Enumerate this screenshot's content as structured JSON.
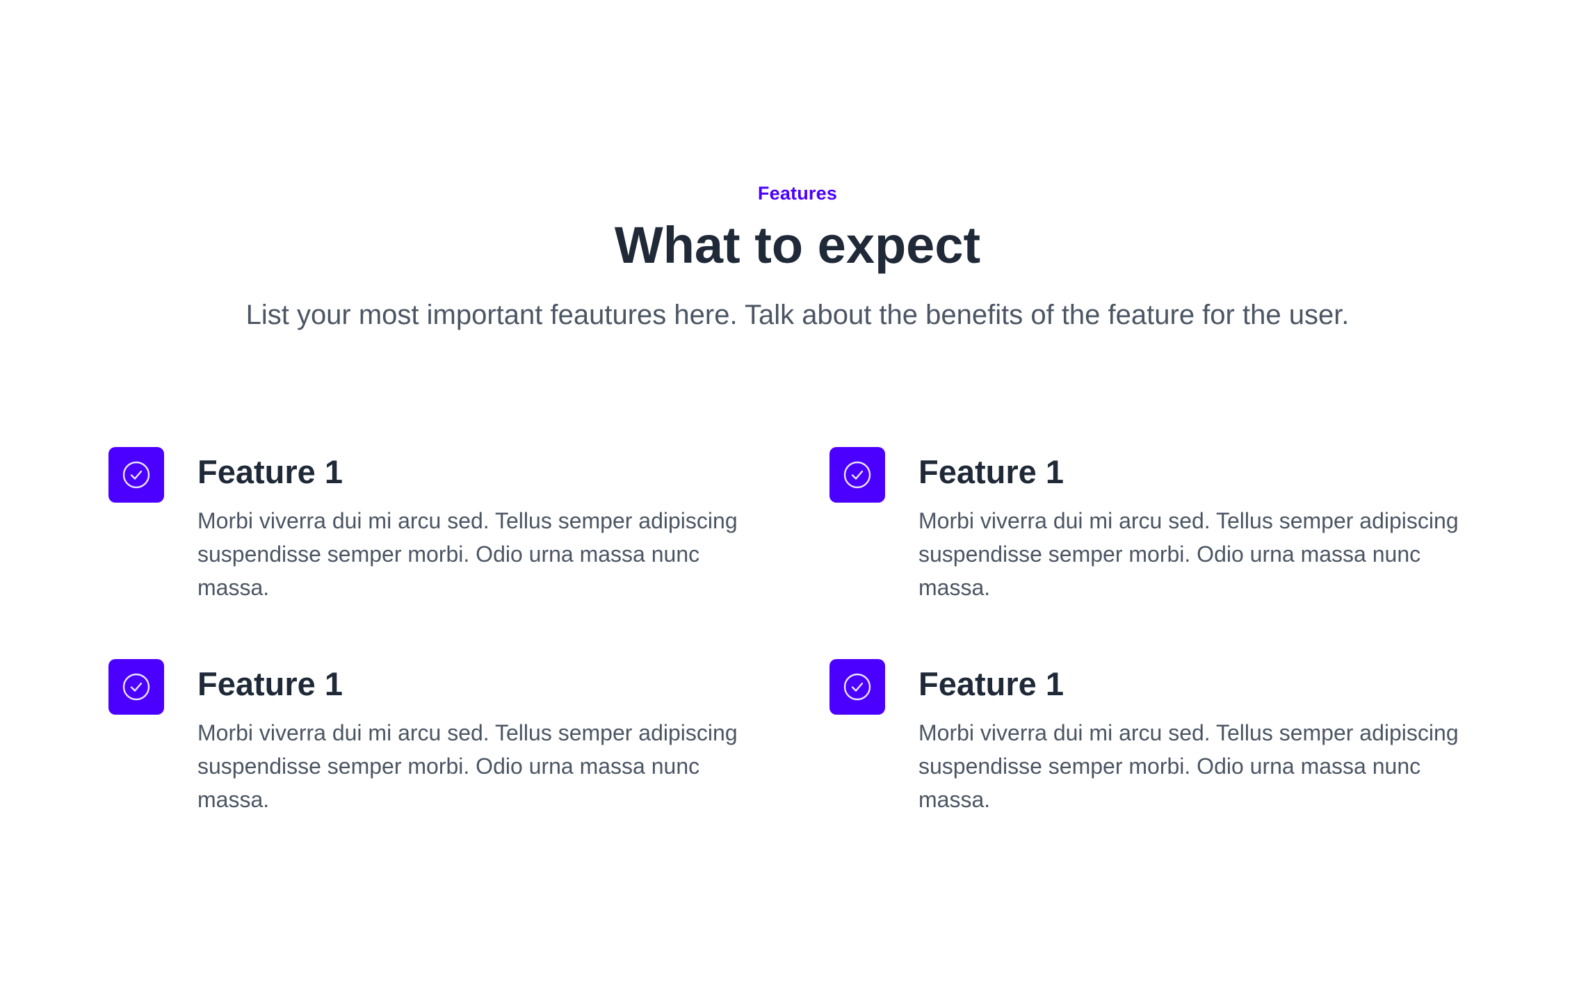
{
  "header": {
    "eyebrow": "Features",
    "title": "What to expect",
    "subtitle": "List your most important feautures here. Talk about the benefits of the feature for the user."
  },
  "features": [
    {
      "icon": "check-circle-icon",
      "title": "Feature 1",
      "description": "Morbi viverra dui mi arcu sed. Tellus semper adipiscing suspendisse semper morbi. Odio urna massa nunc massa."
    },
    {
      "icon": "check-circle-icon",
      "title": "Feature 1",
      "description": "Morbi viverra dui mi arcu sed. Tellus semper adipiscing suspendisse semper morbi. Odio urna massa nunc massa."
    },
    {
      "icon": "check-circle-icon",
      "title": "Feature 1",
      "description": "Morbi viverra dui mi arcu sed. Tellus semper adipiscing suspendisse semper morbi. Odio urna massa nunc massa."
    },
    {
      "icon": "check-circle-icon",
      "title": "Feature 1",
      "description": "Morbi viverra dui mi arcu sed. Tellus semper adipiscing suspendisse semper morbi. Odio urna massa nunc massa."
    }
  ],
  "colors": {
    "accent": "#4b00ff",
    "heading": "#1f2937",
    "body": "#4b5563",
    "background": "#ffffff"
  }
}
